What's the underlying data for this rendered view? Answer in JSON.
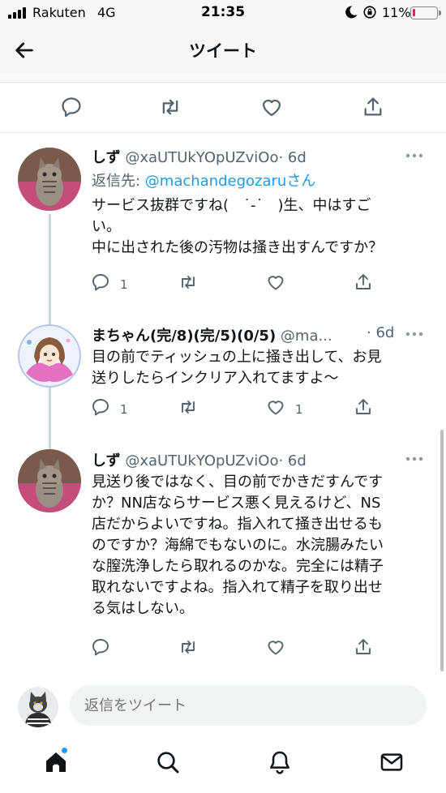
{
  "status_bar": {
    "carrier": "Rakuten",
    "network": "4G",
    "time": "21:35",
    "battery": "11%",
    "battery_color": "#e0245e"
  },
  "header": {
    "title": "ツイート",
    "back_icon": "arrow-left-icon"
  },
  "main_actions": [
    "reply-icon",
    "retweet-icon",
    "like-icon",
    "share-icon"
  ],
  "tweets": [
    {
      "name": "しず",
      "handle": "@xaUTUkYOpUZviOo",
      "time": "· 6d",
      "reply_prefix": "返信先: ",
      "reply_handle": "@machandegozaru",
      "reply_suffix": "さん",
      "body": "サービス抜群ですね(　˙-˙　)生、中はすご\nい。\n中に出された後の汚物は掻き出すんですか？",
      "replies": "1",
      "retweets": "",
      "likes": ""
    },
    {
      "name": "まちゃん(完/8)(完/5)(0/5)",
      "handle": "@ma...",
      "time": "· 6d",
      "body": "目の前でティッシュの上に掻き出して、お見\n送りしたらインクリア入れてますよ～",
      "replies": "1",
      "retweets": "",
      "likes": "1"
    },
    {
      "name": "しず",
      "handle": "@xaUTUkYOpUZviOo",
      "time": "· 6d",
      "body": "見送り後ではなく、目の前でかきだすんです\nか？NN店ならサービス悪く見えるけど、NS\n店だからよいですね。指入れて掻き出せるも\nのですか？海綿でもないのに。水浣腸みたい\nな膣洗浄したら取れるのかな。完全には精子\n取れないですよね。指入れて精子を取り出せ\nる気はしない。",
      "replies": "",
      "retweets": "",
      "likes": ""
    }
  ],
  "reply_bar": {
    "placeholder": "返信をツイート"
  },
  "tab_bar": [
    "home-icon",
    "search-icon",
    "notifications-icon",
    "messages-icon"
  ],
  "accent_color": "#1d9bf0"
}
